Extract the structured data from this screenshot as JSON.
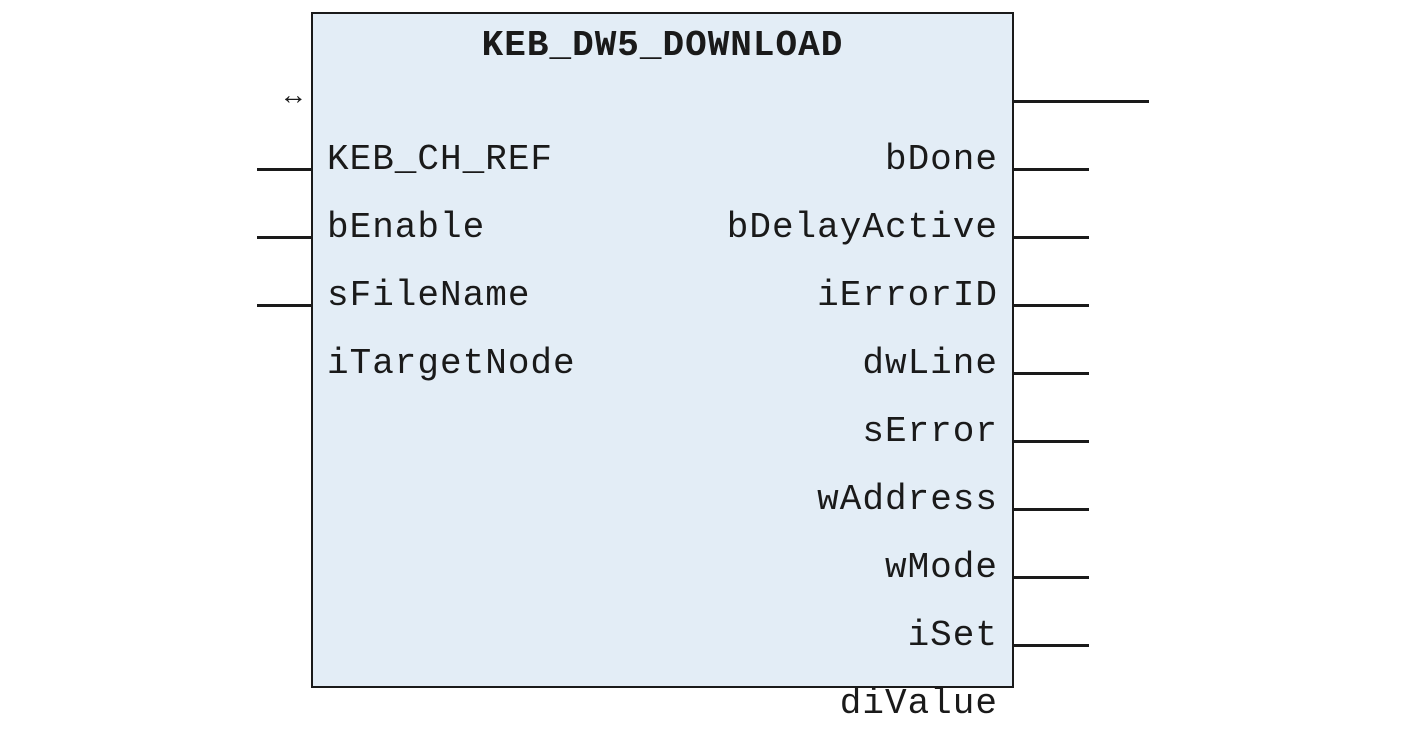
{
  "block": {
    "title": "KEB_DW5_DOWNLOAD",
    "inputs": [
      {
        "label": "KEB_CH_REF",
        "row": 1,
        "ref": true
      },
      {
        "label": "bEnable",
        "row": 2,
        "ref": false
      },
      {
        "label": "sFileName",
        "row": 3,
        "ref": false
      },
      {
        "label": "iTargetNode",
        "row": 4,
        "ref": false
      }
    ],
    "outputs": [
      {
        "label": "bDone",
        "row": 1,
        "longwire": true
      },
      {
        "label": "bDelayActive",
        "row": 2,
        "longwire": false
      },
      {
        "label": "iErrorID",
        "row": 3,
        "longwire": false
      },
      {
        "label": "dwLine",
        "row": 4,
        "longwire": false
      },
      {
        "label": "sError",
        "row": 5,
        "longwire": false
      },
      {
        "label": "wAddress",
        "row": 6,
        "longwire": false
      },
      {
        "label": "wMode",
        "row": 7,
        "longwire": false
      },
      {
        "label": "iSet",
        "row": 8,
        "longwire": false
      },
      {
        "label": "diValue",
        "row": 9,
        "longwire": false
      }
    ]
  },
  "glyphs": {
    "bidir_arrow": "↔"
  }
}
